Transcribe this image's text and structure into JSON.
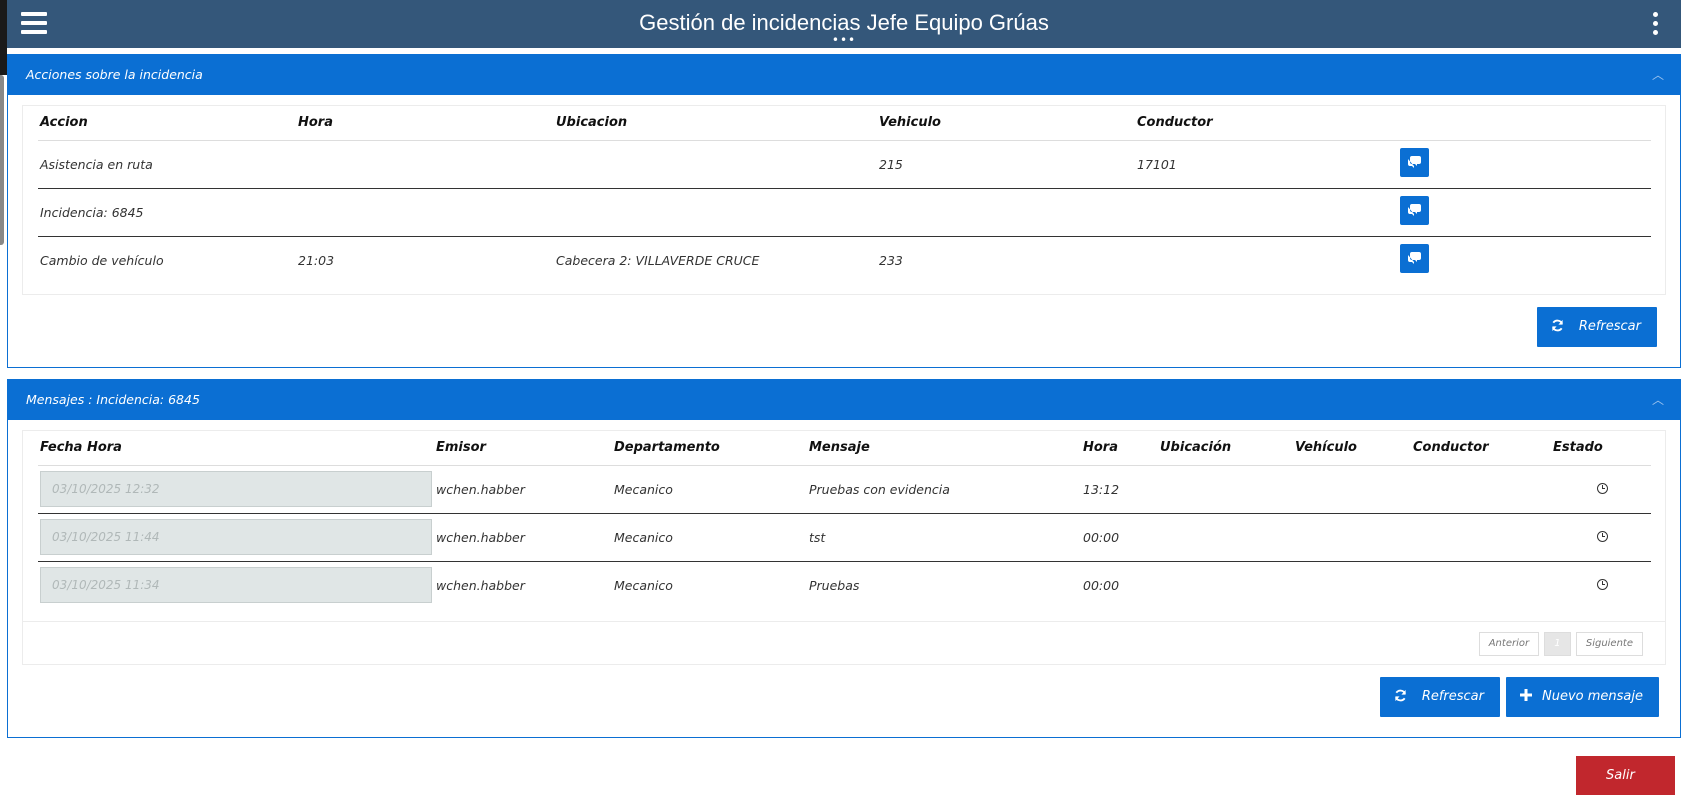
{
  "header": {
    "title": "Gestión de incidencias Jefe Equipo Grúas"
  },
  "acciones": {
    "panel_title": "Acciones sobre la incidencia",
    "columns": [
      "Accion",
      "Hora",
      "Ubicacion",
      "Vehiculo",
      "Conductor"
    ],
    "rows": [
      {
        "accion": "Asistencia en ruta",
        "hora": "",
        "ubicacion": "",
        "vehiculo": "215",
        "conductor": "17101"
      },
      {
        "accion": "Incidencia: 6845",
        "hora": "",
        "ubicacion": "",
        "vehiculo": "",
        "conductor": ""
      },
      {
        "accion": "Cambio de vehículo",
        "hora": "21:03",
        "ubicacion": "Cabecera 2: VILLAVERDE CRUCE",
        "vehiculo": "233",
        "conductor": ""
      }
    ],
    "refresh_label": "Refrescar"
  },
  "mensajes": {
    "panel_title": "Mensajes : Incidencia: 6845",
    "columns": [
      "Fecha Hora",
      "Emisor",
      "Departamento",
      "Mensaje",
      "Hora",
      "Ubicación",
      "Vehículo",
      "Conductor",
      "Estado"
    ],
    "rows": [
      {
        "fecha": "03/10/2025 12:32",
        "emisor": "wchen.habber",
        "departamento": "Mecanico",
        "mensaje": "Pruebas con evidencia",
        "hora": "13:12",
        "ubicacion": "",
        "vehiculo": "",
        "conductor": ""
      },
      {
        "fecha": "03/10/2025 11:44",
        "emisor": "wchen.habber",
        "departamento": "Mecanico",
        "mensaje": "tst",
        "hora": "00:00",
        "ubicacion": "",
        "vehiculo": "",
        "conductor": ""
      },
      {
        "fecha": "03/10/2025 11:34",
        "emisor": "wchen.habber",
        "departamento": "Mecanico",
        "mensaje": "Pruebas",
        "hora": "00:00",
        "ubicacion": "",
        "vehiculo": "",
        "conductor": ""
      }
    ],
    "pager": {
      "prev": "Anterior",
      "page": "1",
      "next": "Siguiente"
    },
    "refresh_label": "Refrescar",
    "new_label": "Nuevo mensaje"
  },
  "exit_label": "Salir",
  "colors": {
    "header": "#34577a",
    "accent": "#0b6fd3",
    "danger": "#c1272d"
  }
}
